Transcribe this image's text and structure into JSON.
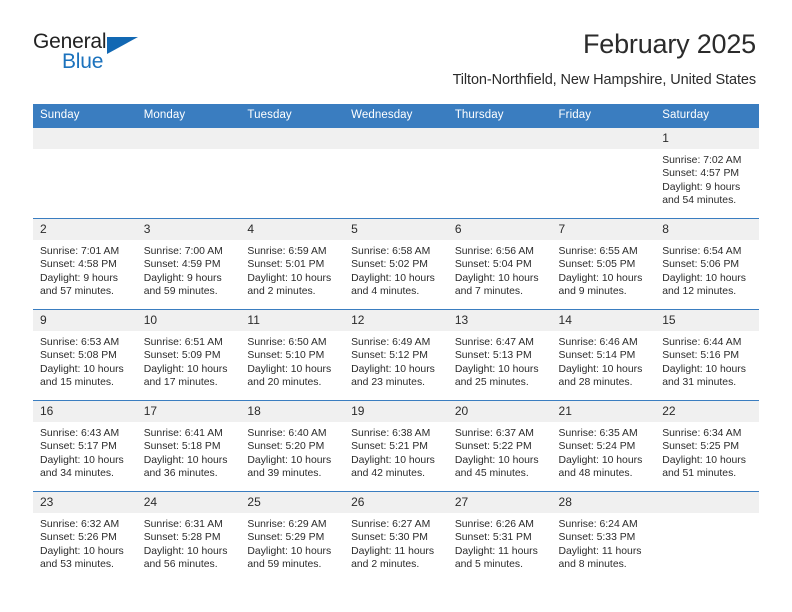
{
  "brand": {
    "name_part1": "General",
    "name_part2": "Blue",
    "logo_icon": "triangle-logo-icon"
  },
  "header": {
    "title": "February 2025",
    "location": "Tilton-Northfield, New Hampshire, United States"
  },
  "calendar": {
    "weekday_headers": [
      "Sunday",
      "Monday",
      "Tuesday",
      "Wednesday",
      "Thursday",
      "Friday",
      "Saturday"
    ],
    "accent_color": "#3a7dc0",
    "daynum_band_color": "#f0f0f0",
    "labels": {
      "sunrise": "Sunrise:",
      "sunset": "Sunset:",
      "daylight": "Daylight:"
    },
    "weeks": [
      [
        {
          "day": "",
          "empty": true
        },
        {
          "day": "",
          "empty": true
        },
        {
          "day": "",
          "empty": true
        },
        {
          "day": "",
          "empty": true
        },
        {
          "day": "",
          "empty": true
        },
        {
          "day": "",
          "empty": true
        },
        {
          "day": "1",
          "sunrise": "Sunrise: 7:02 AM",
          "sunset": "Sunset: 4:57 PM",
          "daylight_1": "Daylight: 9 hours",
          "daylight_2": "and 54 minutes."
        }
      ],
      [
        {
          "day": "2",
          "sunrise": "Sunrise: 7:01 AM",
          "sunset": "Sunset: 4:58 PM",
          "daylight_1": "Daylight: 9 hours",
          "daylight_2": "and 57 minutes."
        },
        {
          "day": "3",
          "sunrise": "Sunrise: 7:00 AM",
          "sunset": "Sunset: 4:59 PM",
          "daylight_1": "Daylight: 9 hours",
          "daylight_2": "and 59 minutes."
        },
        {
          "day": "4",
          "sunrise": "Sunrise: 6:59 AM",
          "sunset": "Sunset: 5:01 PM",
          "daylight_1": "Daylight: 10 hours",
          "daylight_2": "and 2 minutes."
        },
        {
          "day": "5",
          "sunrise": "Sunrise: 6:58 AM",
          "sunset": "Sunset: 5:02 PM",
          "daylight_1": "Daylight: 10 hours",
          "daylight_2": "and 4 minutes."
        },
        {
          "day": "6",
          "sunrise": "Sunrise: 6:56 AM",
          "sunset": "Sunset: 5:04 PM",
          "daylight_1": "Daylight: 10 hours",
          "daylight_2": "and 7 minutes."
        },
        {
          "day": "7",
          "sunrise": "Sunrise: 6:55 AM",
          "sunset": "Sunset: 5:05 PM",
          "daylight_1": "Daylight: 10 hours",
          "daylight_2": "and 9 minutes."
        },
        {
          "day": "8",
          "sunrise": "Sunrise: 6:54 AM",
          "sunset": "Sunset: 5:06 PM",
          "daylight_1": "Daylight: 10 hours",
          "daylight_2": "and 12 minutes."
        }
      ],
      [
        {
          "day": "9",
          "sunrise": "Sunrise: 6:53 AM",
          "sunset": "Sunset: 5:08 PM",
          "daylight_1": "Daylight: 10 hours",
          "daylight_2": "and 15 minutes."
        },
        {
          "day": "10",
          "sunrise": "Sunrise: 6:51 AM",
          "sunset": "Sunset: 5:09 PM",
          "daylight_1": "Daylight: 10 hours",
          "daylight_2": "and 17 minutes."
        },
        {
          "day": "11",
          "sunrise": "Sunrise: 6:50 AM",
          "sunset": "Sunset: 5:10 PM",
          "daylight_1": "Daylight: 10 hours",
          "daylight_2": "and 20 minutes."
        },
        {
          "day": "12",
          "sunrise": "Sunrise: 6:49 AM",
          "sunset": "Sunset: 5:12 PM",
          "daylight_1": "Daylight: 10 hours",
          "daylight_2": "and 23 minutes."
        },
        {
          "day": "13",
          "sunrise": "Sunrise: 6:47 AM",
          "sunset": "Sunset: 5:13 PM",
          "daylight_1": "Daylight: 10 hours",
          "daylight_2": "and 25 minutes."
        },
        {
          "day": "14",
          "sunrise": "Sunrise: 6:46 AM",
          "sunset": "Sunset: 5:14 PM",
          "daylight_1": "Daylight: 10 hours",
          "daylight_2": "and 28 minutes."
        },
        {
          "day": "15",
          "sunrise": "Sunrise: 6:44 AM",
          "sunset": "Sunset: 5:16 PM",
          "daylight_1": "Daylight: 10 hours",
          "daylight_2": "and 31 minutes."
        }
      ],
      [
        {
          "day": "16",
          "sunrise": "Sunrise: 6:43 AM",
          "sunset": "Sunset: 5:17 PM",
          "daylight_1": "Daylight: 10 hours",
          "daylight_2": "and 34 minutes."
        },
        {
          "day": "17",
          "sunrise": "Sunrise: 6:41 AM",
          "sunset": "Sunset: 5:18 PM",
          "daylight_1": "Daylight: 10 hours",
          "daylight_2": "and 36 minutes."
        },
        {
          "day": "18",
          "sunrise": "Sunrise: 6:40 AM",
          "sunset": "Sunset: 5:20 PM",
          "daylight_1": "Daylight: 10 hours",
          "daylight_2": "and 39 minutes."
        },
        {
          "day": "19",
          "sunrise": "Sunrise: 6:38 AM",
          "sunset": "Sunset: 5:21 PM",
          "daylight_1": "Daylight: 10 hours",
          "daylight_2": "and 42 minutes."
        },
        {
          "day": "20",
          "sunrise": "Sunrise: 6:37 AM",
          "sunset": "Sunset: 5:22 PM",
          "daylight_1": "Daylight: 10 hours",
          "daylight_2": "and 45 minutes."
        },
        {
          "day": "21",
          "sunrise": "Sunrise: 6:35 AM",
          "sunset": "Sunset: 5:24 PM",
          "daylight_1": "Daylight: 10 hours",
          "daylight_2": "and 48 minutes."
        },
        {
          "day": "22",
          "sunrise": "Sunrise: 6:34 AM",
          "sunset": "Sunset: 5:25 PM",
          "daylight_1": "Daylight: 10 hours",
          "daylight_2": "and 51 minutes."
        }
      ],
      [
        {
          "day": "23",
          "sunrise": "Sunrise: 6:32 AM",
          "sunset": "Sunset: 5:26 PM",
          "daylight_1": "Daylight: 10 hours",
          "daylight_2": "and 53 minutes."
        },
        {
          "day": "24",
          "sunrise": "Sunrise: 6:31 AM",
          "sunset": "Sunset: 5:28 PM",
          "daylight_1": "Daylight: 10 hours",
          "daylight_2": "and 56 minutes."
        },
        {
          "day": "25",
          "sunrise": "Sunrise: 6:29 AM",
          "sunset": "Sunset: 5:29 PM",
          "daylight_1": "Daylight: 10 hours",
          "daylight_2": "and 59 minutes."
        },
        {
          "day": "26",
          "sunrise": "Sunrise: 6:27 AM",
          "sunset": "Sunset: 5:30 PM",
          "daylight_1": "Daylight: 11 hours",
          "daylight_2": "and 2 minutes."
        },
        {
          "day": "27",
          "sunrise": "Sunrise: 6:26 AM",
          "sunset": "Sunset: 5:31 PM",
          "daylight_1": "Daylight: 11 hours",
          "daylight_2": "and 5 minutes."
        },
        {
          "day": "28",
          "sunrise": "Sunrise: 6:24 AM",
          "sunset": "Sunset: 5:33 PM",
          "daylight_1": "Daylight: 11 hours",
          "daylight_2": "and 8 minutes."
        },
        {
          "day": "",
          "empty": true
        }
      ]
    ]
  }
}
